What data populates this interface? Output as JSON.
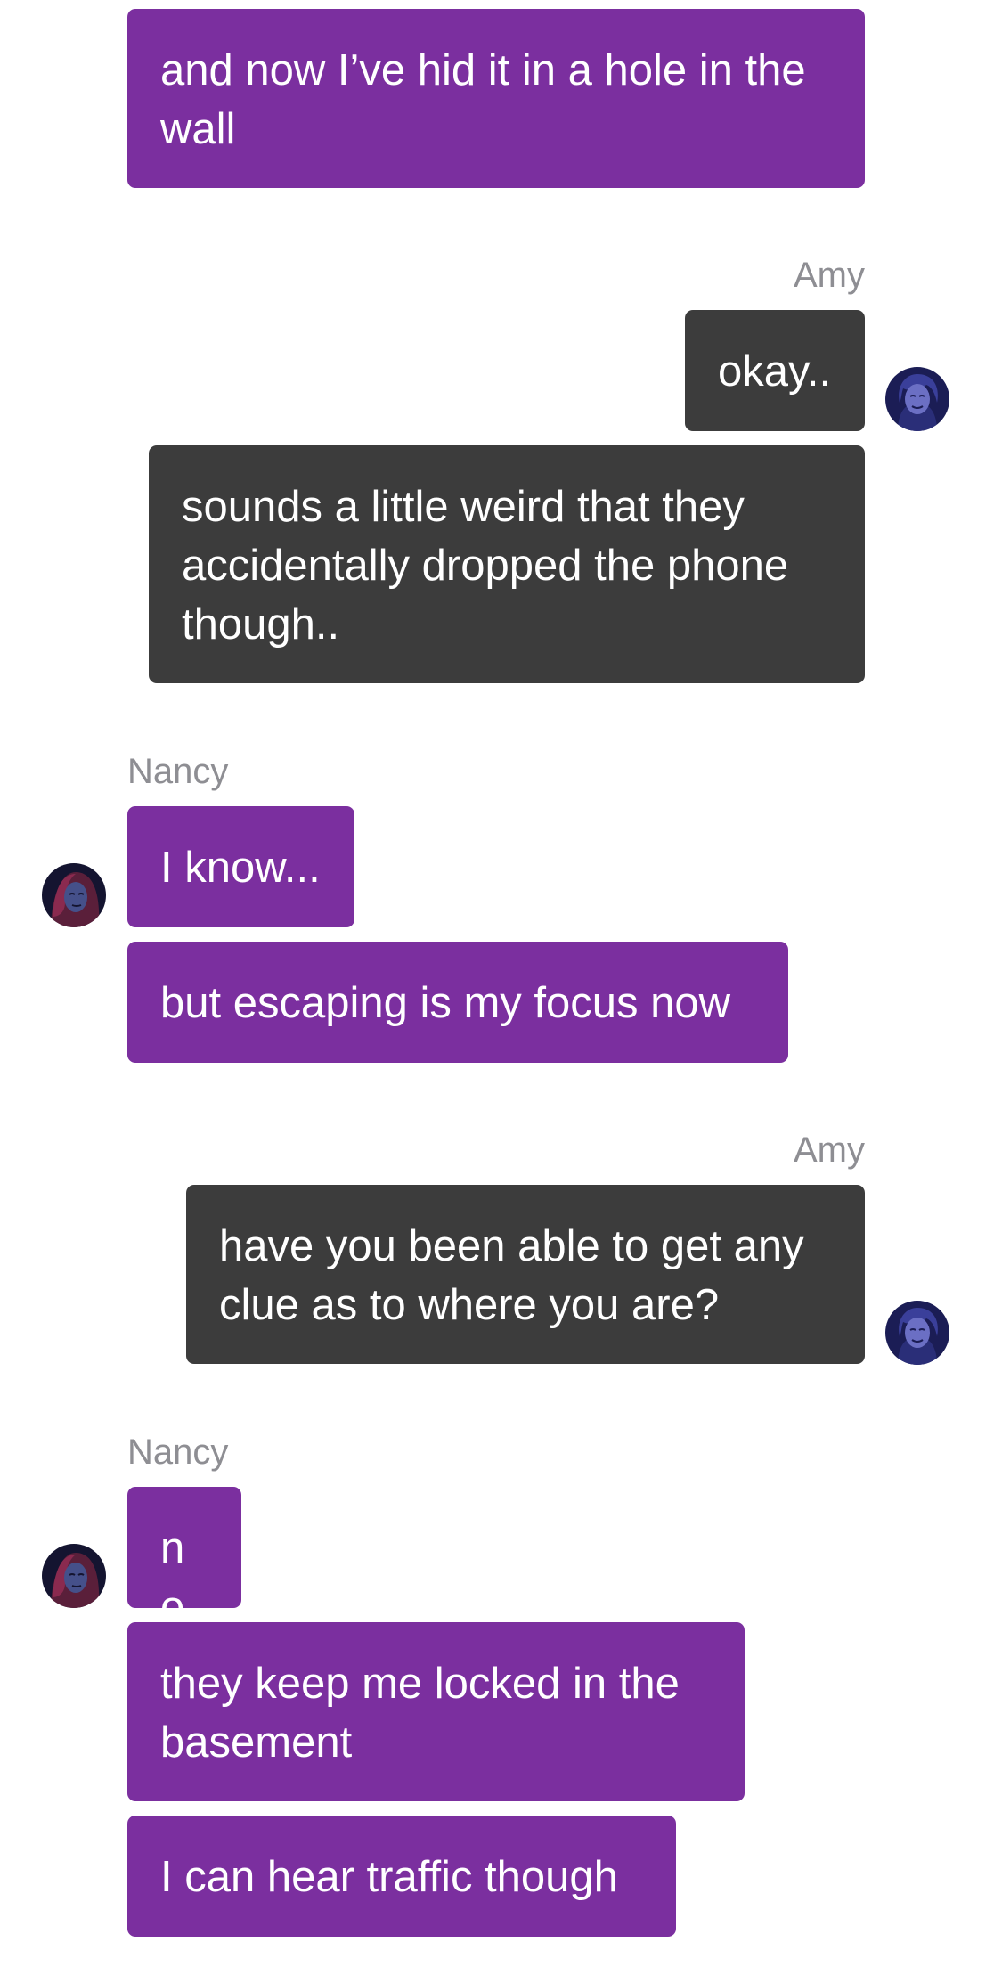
{
  "conversation": {
    "messages": [
      {
        "sender": "Nancy",
        "text": "and now I’ve hid it in a hole in the wall"
      },
      {
        "sender": "Amy",
        "text": "okay.."
      },
      {
        "sender": "Amy",
        "text": "sounds a little weird that they accidentally dropped the phone though.."
      },
      {
        "sender": "Nancy",
        "text": "I know..."
      },
      {
        "sender": "Nancy",
        "text": "but escaping is my focus now"
      },
      {
        "sender": "Amy",
        "text": "have you been able to get any clue as to where you are?"
      },
      {
        "sender": "Nancy",
        "text": "no"
      },
      {
        "sender": "Nancy",
        "text": "they keep me locked in the basement"
      },
      {
        "sender": "Nancy",
        "text": "I can hear traffic though"
      }
    ],
    "groups": [
      {
        "sender_label": "Amy"
      },
      {
        "sender_label": "Nancy"
      },
      {
        "sender_label": "Amy"
      },
      {
        "sender_label": "Nancy"
      }
    ]
  },
  "theme": {
    "nancy_bubble_color": "#7b2f9f",
    "amy_bubble_color": "#3c3c3c",
    "sender_label_color": "#8e8e93",
    "amy_avatar_icon": "amy-avatar-icon",
    "nancy_avatar_icon": "nancy-avatar-icon"
  }
}
